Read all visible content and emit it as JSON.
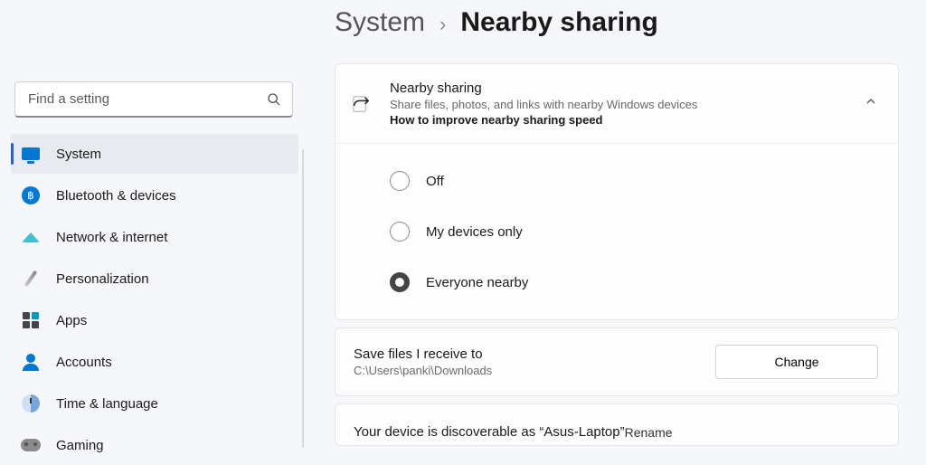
{
  "search": {
    "placeholder": "Find a setting"
  },
  "nav": {
    "items": [
      {
        "id": "system",
        "label": "System",
        "active": true
      },
      {
        "id": "bluetooth",
        "label": "Bluetooth & devices",
        "active": false
      },
      {
        "id": "network",
        "label": "Network & internet",
        "active": false
      },
      {
        "id": "personalization",
        "label": "Personalization",
        "active": false
      },
      {
        "id": "apps",
        "label": "Apps",
        "active": false
      },
      {
        "id": "accounts",
        "label": "Accounts",
        "active": false
      },
      {
        "id": "time",
        "label": "Time & language",
        "active": false
      },
      {
        "id": "gaming",
        "label": "Gaming",
        "active": false
      }
    ]
  },
  "breadcrumb": {
    "parent": "System",
    "current": "Nearby sharing"
  },
  "card": {
    "title": "Nearby sharing",
    "subtitle": "Share files, photos, and links with nearby Windows devices",
    "help_link": "How to improve nearby sharing speed",
    "options": [
      {
        "id": "off",
        "label": "Off",
        "selected": false
      },
      {
        "id": "my-devices",
        "label": "My devices only",
        "selected": false
      },
      {
        "id": "everyone",
        "label": "Everyone nearby",
        "selected": true
      }
    ]
  },
  "save_row": {
    "title": "Save files I receive to",
    "path": "C:\\Users\\panki\\Downloads",
    "button": "Change"
  },
  "discover_row": {
    "text": "Your device is discoverable as “Asus-Laptop”",
    "action": "Rename"
  }
}
